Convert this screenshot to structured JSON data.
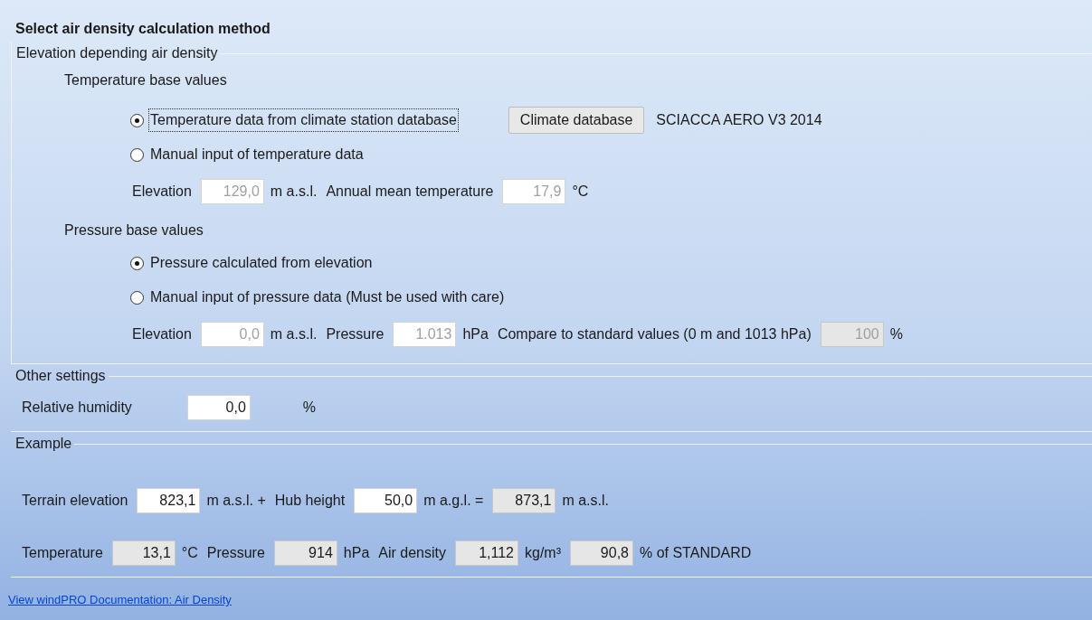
{
  "title": "Select air density calculation method",
  "groups": [
    {
      "title": "Elevation depending air density",
      "items": [
        {
          "kind": "heading",
          "text": "Temperature base values"
        },
        {
          "kind": "radio",
          "label": "Temperature data from climate station database",
          "selected": true,
          "focused": true,
          "button": "Climate database",
          "note": "SCIACCA AERO V3 2014"
        },
        {
          "kind": "radio",
          "label": "Manual input of temperature data",
          "selected": false,
          "focused": false
        },
        {
          "kind": "row",
          "items": [
            {
              "kind": "label",
              "text": "Elevation"
            },
            {
              "kind": "field",
              "value": "129,0",
              "disabled": true,
              "readonly": false
            },
            {
              "kind": "label",
              "text": "m a.s.l."
            },
            {
              "kind": "label",
              "text": "Annual mean temperature"
            },
            {
              "kind": "field",
              "value": "17,9",
              "disabled": true,
              "readonly": false
            },
            {
              "kind": "label",
              "text": "°C"
            }
          ]
        },
        {
          "kind": "heading",
          "text": "Pressure base values"
        },
        {
          "kind": "radio",
          "label": "Pressure calculated from elevation",
          "selected": true,
          "focused": false
        },
        {
          "kind": "radio",
          "label": "Manual input of pressure data (Must be used with care)",
          "selected": false,
          "focused": false
        },
        {
          "kind": "row",
          "items": [
            {
              "kind": "label",
              "text": "Elevation"
            },
            {
              "kind": "field",
              "value": "0,0",
              "disabled": true,
              "readonly": false
            },
            {
              "kind": "label",
              "text": "m a.s.l."
            },
            {
              "kind": "label",
              "text": "Pressure"
            },
            {
              "kind": "field",
              "value": "1.013",
              "disabled": true,
              "readonly": false
            },
            {
              "kind": "label",
              "text": "hPa"
            },
            {
              "kind": "label",
              "text": "Compare to standard values (0 m and 1013 hPa)"
            },
            {
              "kind": "field",
              "value": "100",
              "disabled": true,
              "readonly": true
            },
            {
              "kind": "label",
              "text": "%"
            }
          ]
        }
      ]
    },
    {
      "title": "Other settings",
      "items": [
        {
          "kind": "row",
          "items": [
            {
              "kind": "label",
              "text": "Relative humidity"
            },
            {
              "kind": "field",
              "value": "0,0",
              "disabled": false,
              "readonly": false
            },
            {
              "kind": "label",
              "text": "%"
            }
          ]
        }
      ]
    },
    {
      "title": "Example",
      "items": [
        {
          "kind": "row",
          "items": [
            {
              "kind": "label",
              "text": "Terrain elevation"
            },
            {
              "kind": "field",
              "value": "823,1",
              "disabled": false,
              "readonly": false
            },
            {
              "kind": "label",
              "text": "m a.s.l. +"
            },
            {
              "kind": "label",
              "text": "Hub height"
            },
            {
              "kind": "field",
              "value": "50,0",
              "disabled": false,
              "readonly": false
            },
            {
              "kind": "label",
              "text": "m a.g.l. ="
            },
            {
              "kind": "field",
              "value": "873,1",
              "disabled": false,
              "readonly": true
            },
            {
              "kind": "label",
              "text": "m a.s.l."
            }
          ]
        },
        {
          "kind": "row",
          "items": [
            {
              "kind": "label",
              "text": "Temperature"
            },
            {
              "kind": "field",
              "value": "13,1",
              "disabled": false,
              "readonly": true
            },
            {
              "kind": "label",
              "text": "°C"
            },
            {
              "kind": "label",
              "text": "Pressure"
            },
            {
              "kind": "field",
              "value": "914",
              "disabled": false,
              "readonly": true
            },
            {
              "kind": "label",
              "text": "hPa"
            },
            {
              "kind": "label",
              "text": "Air density"
            },
            {
              "kind": "field",
              "value": "1,112",
              "disabled": false,
              "readonly": true
            },
            {
              "kind": "label",
              "text": "kg/m³"
            },
            {
              "kind": "field",
              "value": "90,8",
              "disabled": false,
              "readonly": true
            },
            {
              "kind": "label",
              "text": "% of STANDARD"
            }
          ]
        }
      ]
    }
  ],
  "link": "View windPRO Documentation: Air Density"
}
